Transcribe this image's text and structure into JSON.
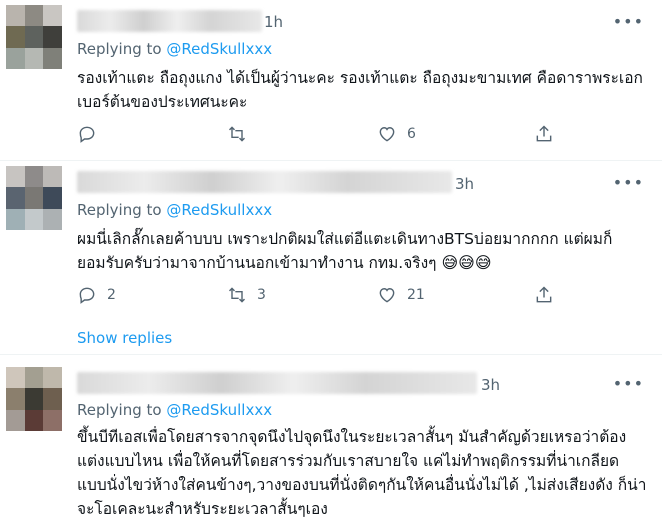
{
  "tweets": [
    {
      "time": "1h",
      "replying_prefix": "Replying to",
      "replying_handle": "@RedSkullxxx",
      "text": "รองเท้าแตะ ถือถุงแกง ได้เป็นผู้ว่านะคะ รองเท้าแตะ ถือถุงมะขามเทศ คือดาราพระเอกเบอร์ต้นของประเทศนะคะ",
      "replies": "",
      "retweets": "",
      "likes": "6",
      "more_icon": "more-dots-icon"
    },
    {
      "time": "3h",
      "replying_prefix": "Replying to",
      "replying_handle": "@RedSkullxxx",
      "text": "ผมนี่เลิกลั๊กเลยค้าบบบ เพราะปกติผมใส่แต่อีแตะเดินทางBTSบ่อยมากกกก แต่ผมก็ยอมรับครับว่ามาจากบ้านนอกเข้ามาทำงาน กทม.จริงๆ",
      "emojis": "😅😅😅",
      "replies": "2",
      "retweets": "3",
      "likes": "21",
      "show_replies": "Show replies"
    },
    {
      "time": "3h",
      "replying_prefix": "Replying to",
      "replying_handle": "@RedSkullxxx",
      "text": "ขึ้นบีทีเอสเพื่อโดยสารจากจุดนึงไปจุดนึงในระยะเวลาสั้นๆ มันสำคัญด้วยเหรอว่าต้องแต่งแบบไหน เพื่อให้คนที่โดยสารร่วมกับเราสบายใจ แค่ไม่ทำพฤติกรรมที่น่าเกลียด แบบนั่งไขว่ห้างใส่คนข้างๆ,วางของบนที่นั่งติดๆกันให้คนอื่นนั่งไม่ได้ ,ไม่ส่งเสียงดัง ก็น่าจะโอเคละนะสำหรับระยะเวลาสั้นๆเอง"
    }
  ]
}
